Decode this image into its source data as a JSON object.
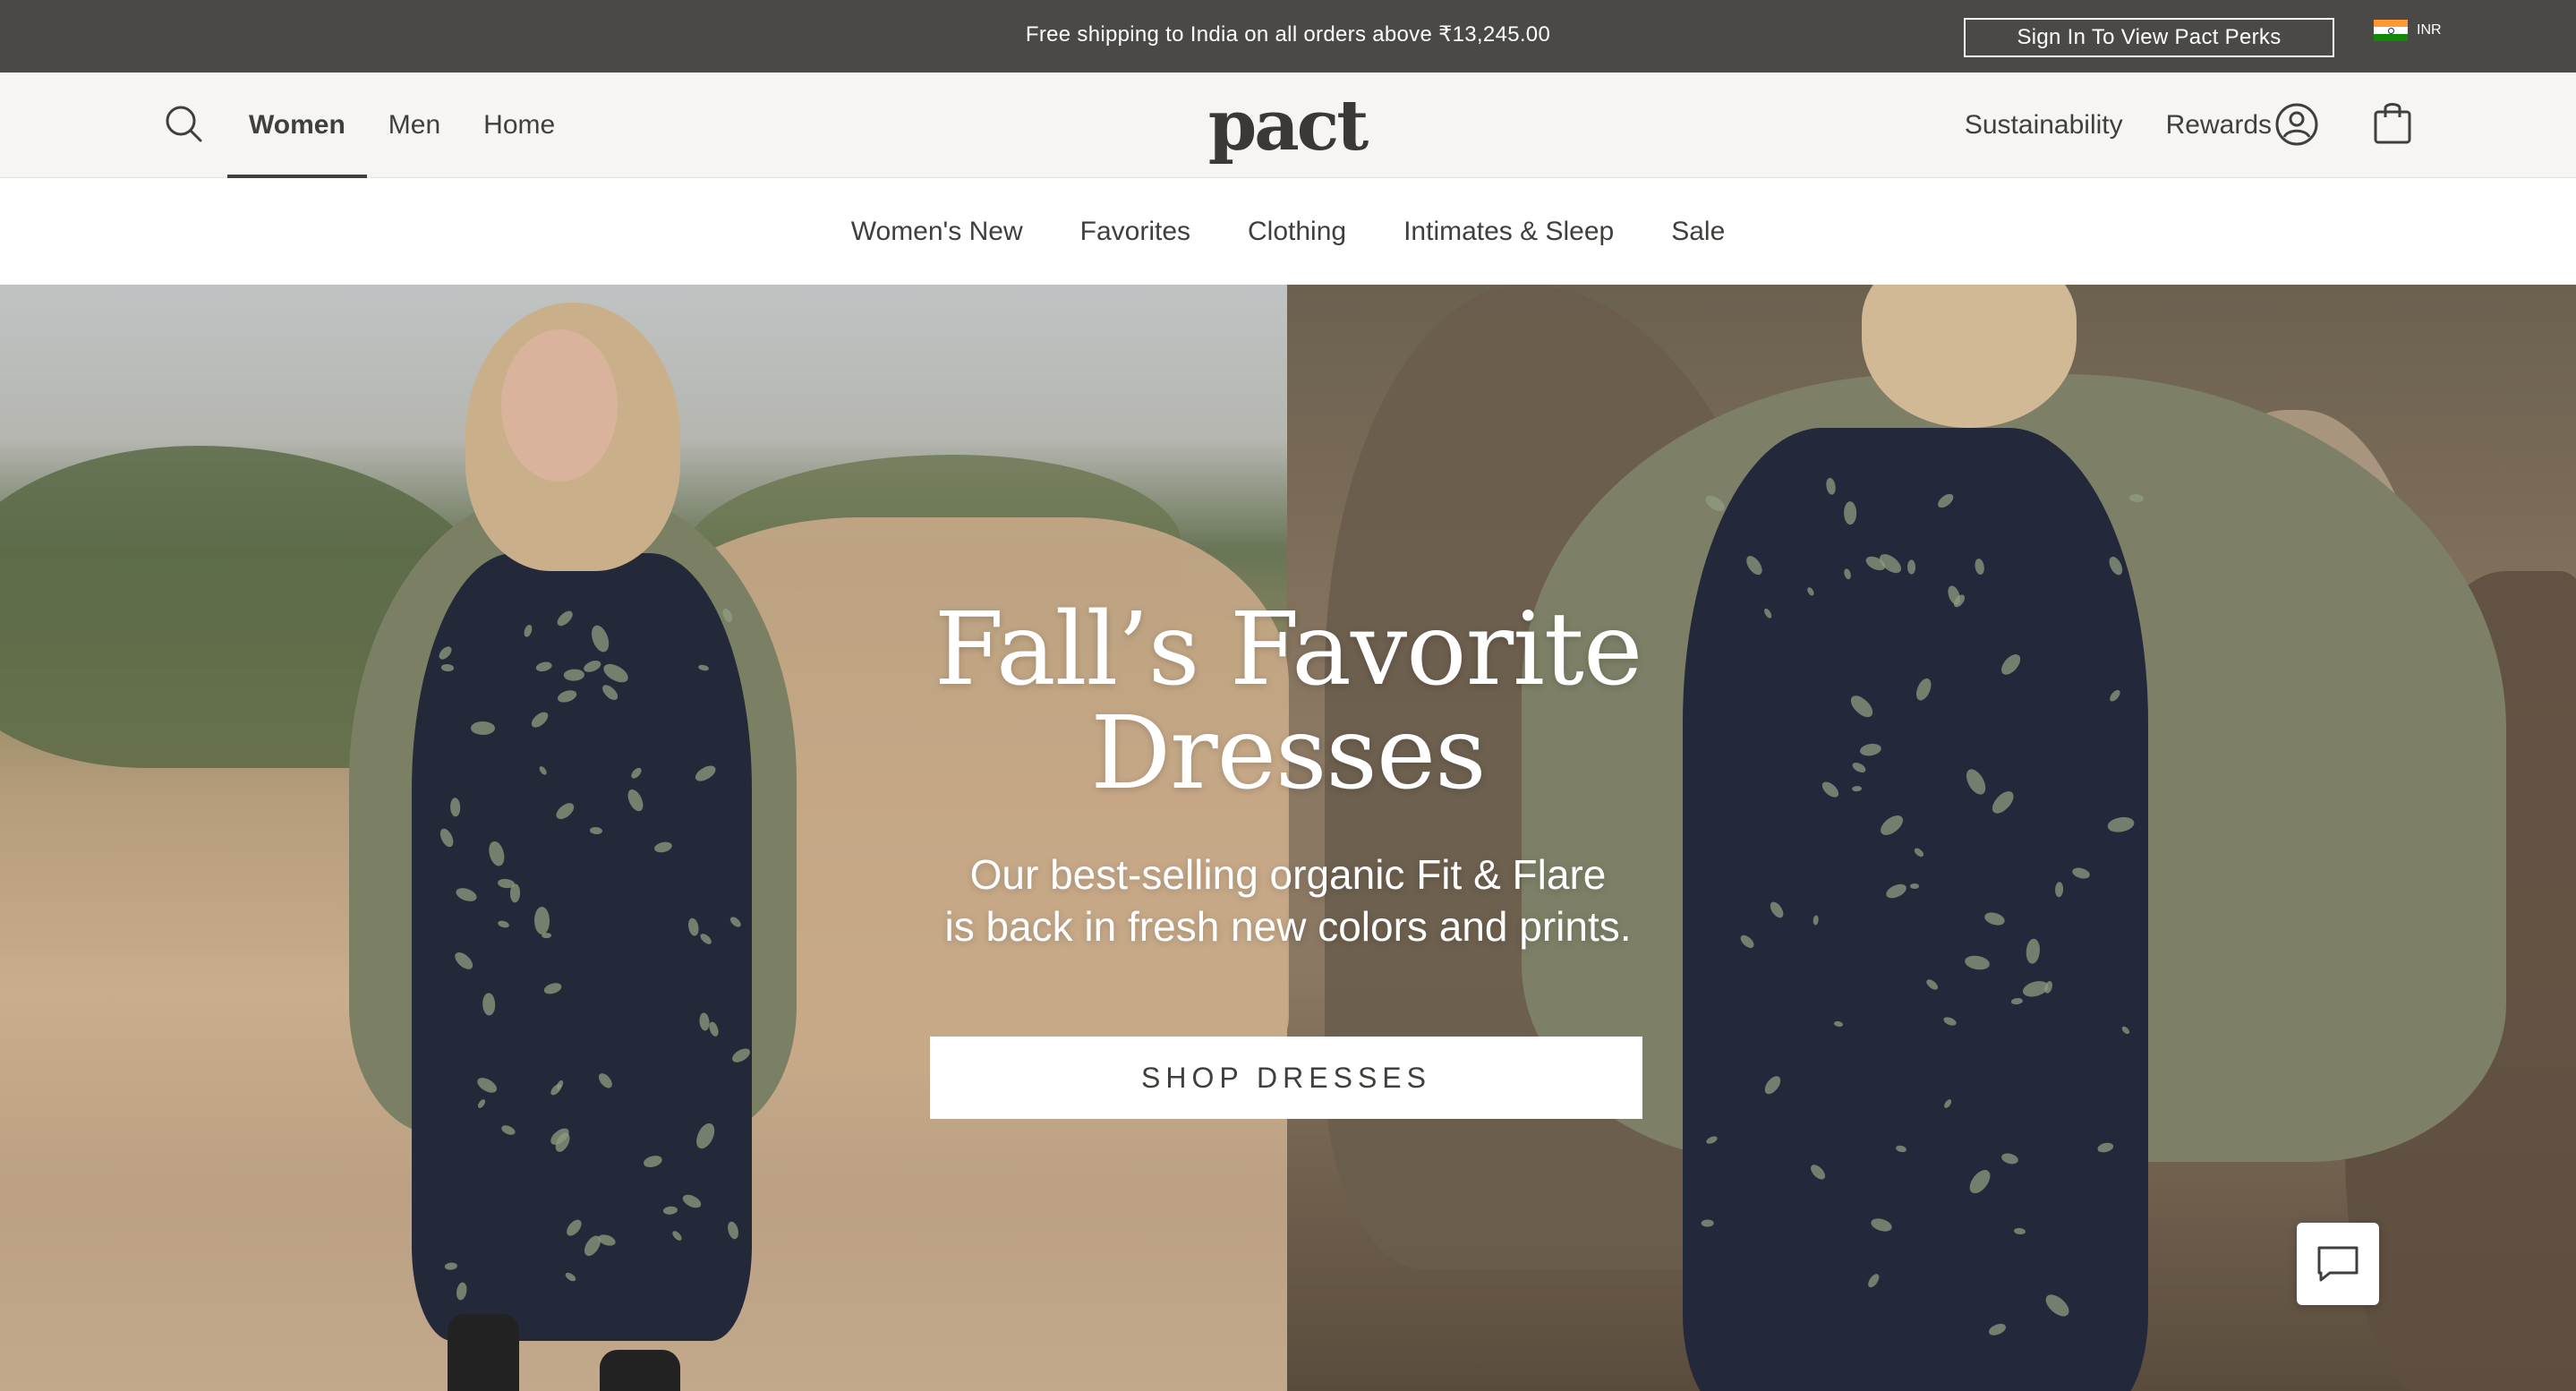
{
  "announcement": {
    "text": "Free shipping to India on all orders above ₹13,245.00",
    "perks_button": "Sign In To View Pact Perks",
    "currency": "INR"
  },
  "header": {
    "logo": "pact",
    "main_nav": [
      {
        "label": "Women",
        "active": true
      },
      {
        "label": "Men",
        "active": false
      },
      {
        "label": "Home",
        "active": false
      }
    ],
    "right_nav": [
      {
        "label": "Sustainability"
      },
      {
        "label": "Rewards"
      }
    ],
    "icons": {
      "search": "search-icon",
      "account": "account-icon",
      "bag": "shopping-bag-icon"
    }
  },
  "subnav": {
    "items": [
      "Women's New",
      "Favorites",
      "Clothing",
      "Intimates & Sleep",
      "Sale"
    ]
  },
  "hero": {
    "title_line1": "Fall’s Favorite",
    "title_line2": "Dresses",
    "subtitle_line1": "Our best-selling organic Fit & Flare",
    "subtitle_line2": "is back in fresh new colors and prints.",
    "cta": "SHOP DRESSES"
  },
  "chat": {
    "icon": "chat-bubble-icon"
  },
  "colors": {
    "announcement_bg": "#4a4945",
    "header_bg": "#f6f5f3",
    "text": "#3f3f3c"
  }
}
